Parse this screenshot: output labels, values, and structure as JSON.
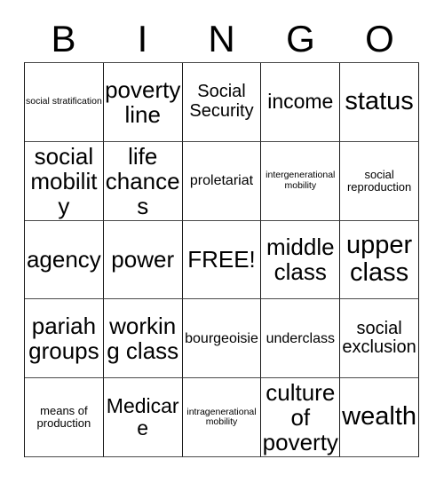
{
  "card": {
    "header_letters": [
      "B",
      "I",
      "N",
      "G",
      "O"
    ],
    "rows": [
      [
        {
          "text": "social stratification",
          "size": "xs"
        },
        {
          "text": "poverty line",
          "size": "xxl"
        },
        {
          "text": "Social Security",
          "size": "lg"
        },
        {
          "text": "income",
          "size": "xl"
        },
        {
          "text": "status",
          "size": "huge"
        }
      ],
      [
        {
          "text": "social mobility",
          "size": "xxl"
        },
        {
          "text": "life chances",
          "size": "xxl"
        },
        {
          "text": "proletariat",
          "size": "md"
        },
        {
          "text": "intergenerational mobility",
          "size": "xs"
        },
        {
          "text": "social reproduction",
          "size": "sm"
        }
      ],
      [
        {
          "text": "agency",
          "size": "xxl"
        },
        {
          "text": "power",
          "size": "xxl"
        },
        {
          "text": "FREE!",
          "size": "xxl"
        },
        {
          "text": "middle class",
          "size": "xxl"
        },
        {
          "text": "upper class",
          "size": "huge"
        }
      ],
      [
        {
          "text": "pariah groups",
          "size": "xxl"
        },
        {
          "text": "working class",
          "size": "xxl"
        },
        {
          "text": "bourgeoisie",
          "size": "md"
        },
        {
          "text": "underclass",
          "size": "md"
        },
        {
          "text": "social exclusion",
          "size": "lg"
        }
      ],
      [
        {
          "text": "means of production",
          "size": "sm"
        },
        {
          "text": "Medicare",
          "size": "xl"
        },
        {
          "text": "intragenerational mobility",
          "size": "xs"
        },
        {
          "text": "culture of poverty",
          "size": "xxl"
        },
        {
          "text": "wealth",
          "size": "huge"
        }
      ]
    ],
    "colors": {
      "background": "#ffffff",
      "text": "#000000",
      "grid_line": "#1a1a1a"
    }
  }
}
